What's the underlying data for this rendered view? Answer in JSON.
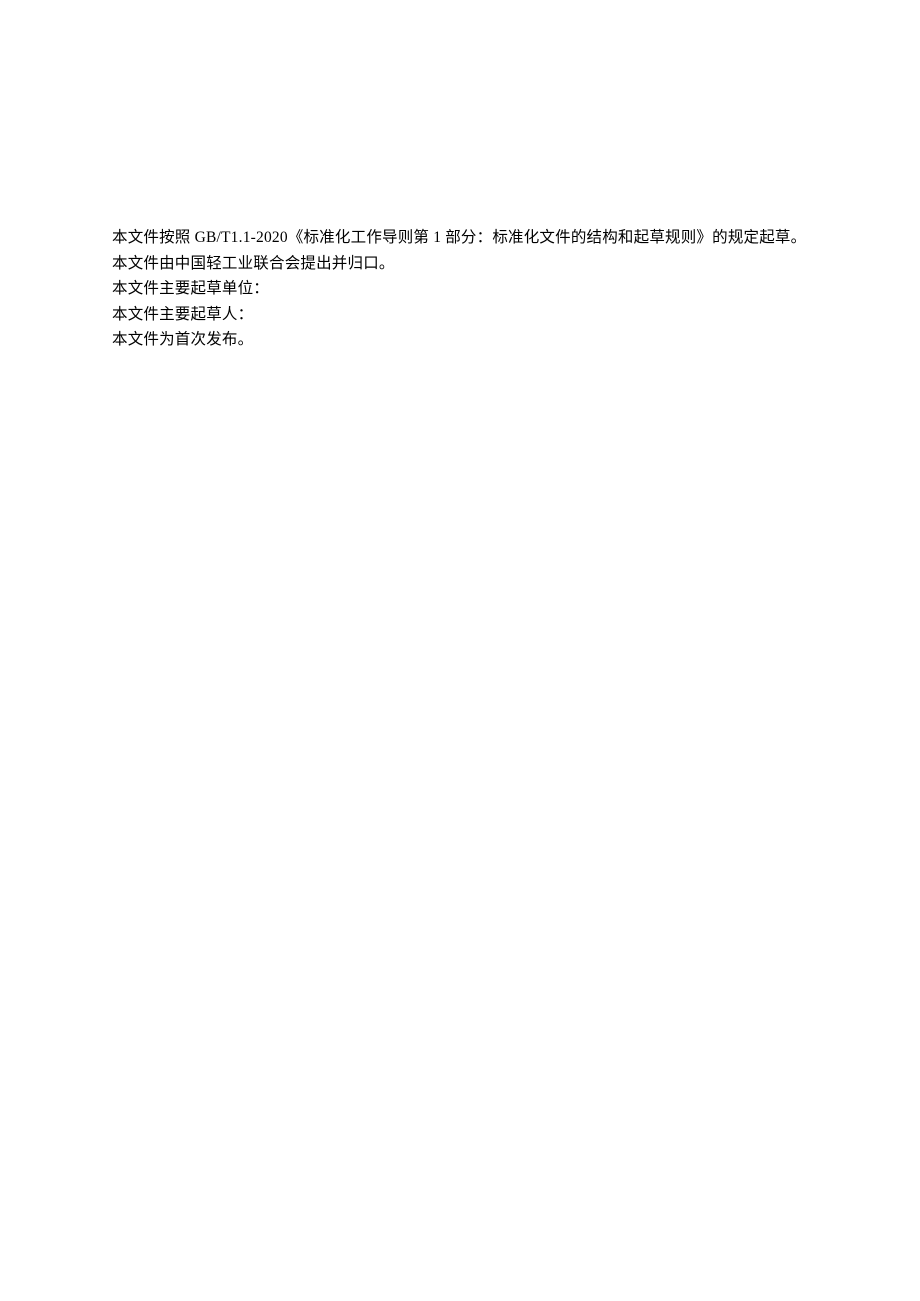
{
  "paragraphs": {
    "line1": "本文件按照 GB/T1.1-2020《标准化工作导则第 1 部分：标准化文件的结构和起草规则》的规定起草。",
    "line2": "本文件由中国轻工业联合会提出并归口。",
    "line3": "本文件主要起草单位：",
    "line4": "本文件主要起草人：",
    "line5": "本文件为首次发布。"
  }
}
